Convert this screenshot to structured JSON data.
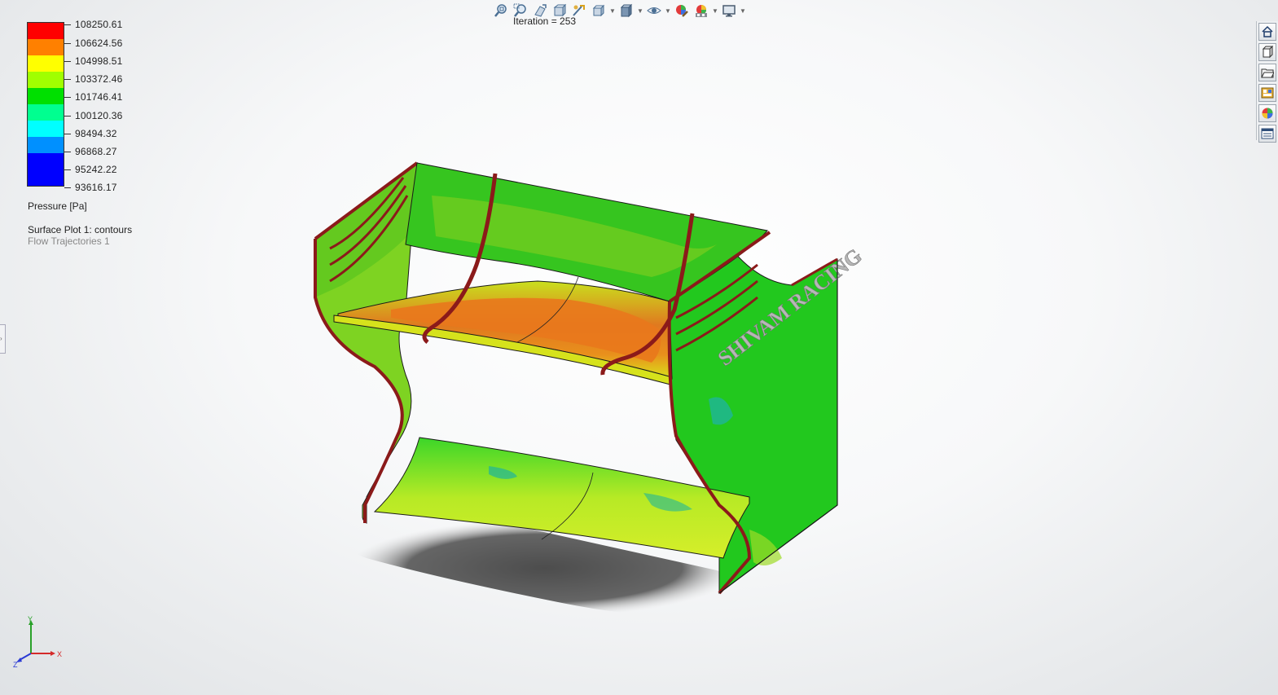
{
  "legend": {
    "levels": [
      "108250.61",
      "106624.56",
      "104998.51",
      "103372.46",
      "101746.41",
      "100120.36",
      "98494.32",
      "96868.27",
      "95242.22",
      "93616.17"
    ],
    "colors": [
      "#ff0000",
      "#ff8000",
      "#ffff00",
      "#a0ff00",
      "#00e000",
      "#00ff90",
      "#00ffff",
      "#0090ff",
      "#0000ff",
      "#0000ff"
    ],
    "title": "Pressure [Pa]",
    "plot_name": "Surface Plot 1: contours",
    "trajectories_name": "Flow Trajectories 1"
  },
  "iteration_label": "Iteration = 253",
  "toolbar": {
    "icons": [
      "zoom-to-fit-icon",
      "zoom-to-area-icon",
      "previous-view-icon",
      "section-view-icon",
      "dynamic-annotation-icon",
      "view-orientation-icon",
      "display-style-icon",
      "hide-show-items-icon",
      "edit-appearance-icon",
      "apply-scene-icon",
      "view-settings-icon"
    ]
  },
  "taskpane": {
    "icons": [
      "home-icon",
      "design-library-icon",
      "file-explorer-icon",
      "view-palette-icon",
      "appearances-icon",
      "custom-properties-icon"
    ]
  },
  "model": {
    "side_text": "SHIVAM RACING"
  },
  "triad": {
    "x_label": "X",
    "y_label": "Y",
    "z_label": "Z"
  },
  "colors": {
    "body_green": "#22c81e",
    "edge_red": "#8b1a1a",
    "high_pressure": "#e9781c",
    "mid_pressure": "#d8e31c"
  }
}
